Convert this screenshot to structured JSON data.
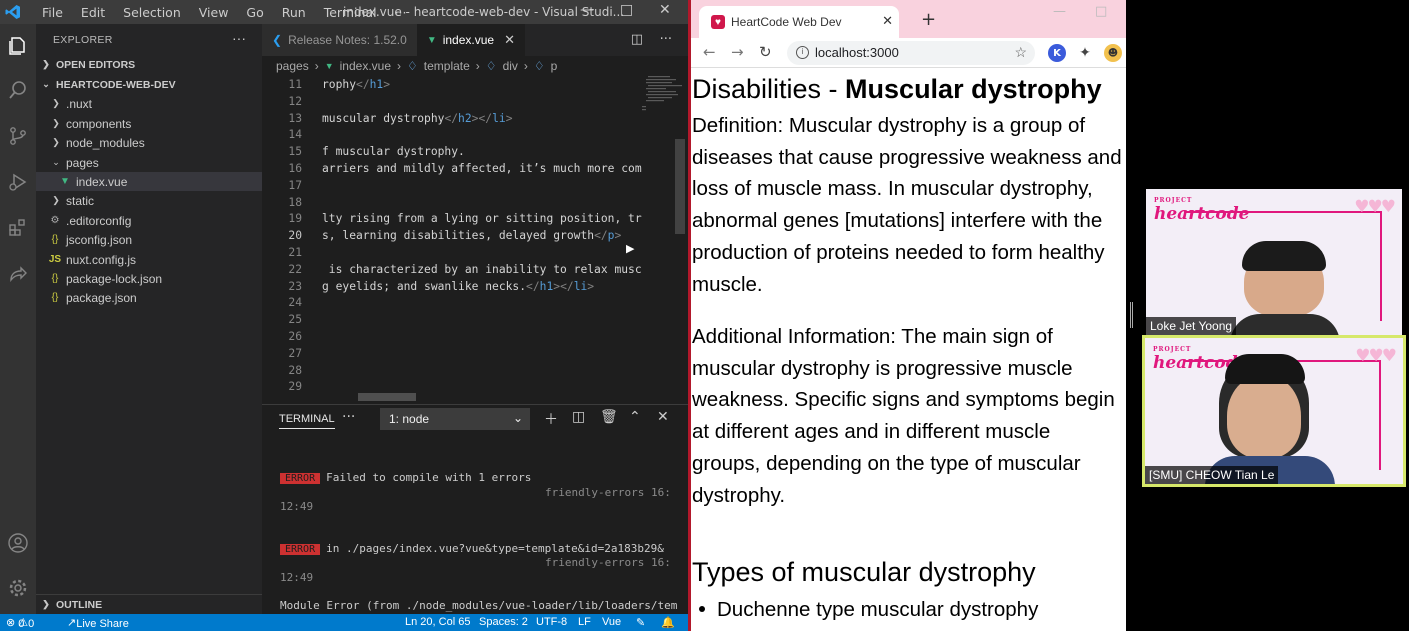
{
  "vscode": {
    "menu": [
      "File",
      "Edit",
      "Selection",
      "View",
      "Go",
      "Run",
      "Terminal",
      "···"
    ],
    "window_title": "index.vue - heartcode-web-dev - Visual Studi...",
    "sidebar": {
      "header": "EXPLORER",
      "open_editors": "OPEN EDITORS",
      "project": "HEARTCODE-WEB-DEV",
      "items": [
        {
          "label": ".nuxt",
          "type": "folder"
        },
        {
          "label": "components",
          "type": "folder"
        },
        {
          "label": "node_modules",
          "type": "folder"
        },
        {
          "label": "pages",
          "type": "folder-open"
        },
        {
          "label": "index.vue",
          "type": "vue"
        },
        {
          "label": "static",
          "type": "folder"
        },
        {
          "label": ".editorconfig",
          "type": "gear"
        },
        {
          "label": "jsconfig.json",
          "type": "json"
        },
        {
          "label": "nuxt.config.js",
          "type": "js"
        },
        {
          "label": "package-lock.json",
          "type": "json"
        },
        {
          "label": "package.json",
          "type": "json"
        }
      ],
      "outline": "OUTLINE"
    },
    "tabs": [
      {
        "label": "Release Notes: 1.52.0",
        "active": false
      },
      {
        "label": "index.vue",
        "active": true
      }
    ],
    "breadcrumbs": [
      "pages",
      "index.vue",
      "template",
      "div",
      "p"
    ],
    "code_lines": [
      {
        "num": "11",
        "text": "rophy</h1>"
      },
      {
        "num": "12",
        "text": ""
      },
      {
        "num": "13",
        "text": "muscular dystrophy</h2></li>"
      },
      {
        "num": "14",
        "text": ""
      },
      {
        "num": "15",
        "text": "f muscular dystrophy."
      },
      {
        "num": "16",
        "text": "arriers and mildly affected, it’s much more com"
      },
      {
        "num": "17",
        "text": ""
      },
      {
        "num": "18",
        "text": ""
      },
      {
        "num": "19",
        "text": "lty rising from a lying or sitting position, tr"
      },
      {
        "num": "20",
        "text": "s, learning disabilities, delayed growth</p>"
      },
      {
        "num": "21",
        "text": ""
      },
      {
        "num": "22",
        "text": " is characterized by an inability to relax musc"
      },
      {
        "num": "23",
        "text": "g eyelids; and swanlike necks.</h1></li>"
      },
      {
        "num": "24",
        "text": ""
      },
      {
        "num": "25",
        "text": ""
      },
      {
        "num": "26",
        "text": ""
      },
      {
        "num": "27",
        "text": ""
      },
      {
        "num": "28",
        "text": ""
      },
      {
        "num": "29",
        "text": ""
      }
    ],
    "panel": {
      "tab": "TERMINAL",
      "more": "···",
      "select": "1: node",
      "lines": [
        {
          "badge": "ERROR",
          "text": "Failed to compile with 1 errors",
          "src": "friendly-errors 16:",
          "time": "12:49"
        },
        {
          "badge": "ERROR",
          "text": "in ./pages/index.vue?vue&type=template&id=2a183b29&",
          "src": "friendly-errors 16:",
          "time": "12:49"
        }
      ],
      "last_line": "Module Error (from ./node_modules/vue-loader/lib/loaders/tem"
    },
    "status": {
      "errors": "0",
      "warnings": "0",
      "live_share": "Live Share",
      "position": "Ln 20, Col 65",
      "spaces": "Spaces: 2",
      "encoding": "UTF-8",
      "eol": "LF",
      "language": "Vue"
    }
  },
  "browser": {
    "tab_title": "HeartCode Web Dev",
    "url": "localhost:3000",
    "page": {
      "heading_prefix": "Disabilities - ",
      "heading_bold": "Muscular dystrophy",
      "definition_lines": [
        "Definition: Muscular dystrophy is a group of",
        "diseases that cause progressive weakness and",
        "loss of muscle mass. In muscular dystrophy,",
        "abnormal genes [mutations] interfere with the",
        "production of proteins needed to form healthy",
        "muscle."
      ],
      "additional_lines": [
        "Additional Information: The main sign of",
        "muscular dystrophy is progressive muscle",
        "weakness. Specific signs and symptoms begin",
        "at different ages and in different muscle",
        "groups, depending on the type of muscular",
        "dystrophy."
      ],
      "types_heading": "Types of muscular dystrophy",
      "types": [
        "Duchenne type muscular dystrophy"
      ]
    }
  },
  "video_call": {
    "brand_top": "PROJECT",
    "brand": "heartcode",
    "participants": [
      {
        "name": "Loke Jet Yoong",
        "speaking": false
      },
      {
        "name": "[SMU] CHEOW Tian Le",
        "speaking": true
      }
    ]
  }
}
